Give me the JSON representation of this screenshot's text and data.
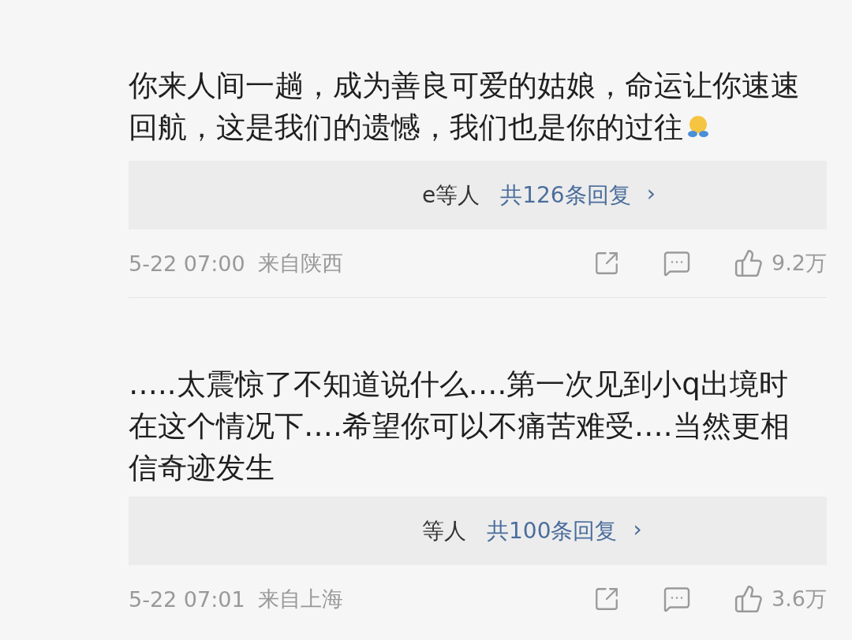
{
  "comments": [
    {
      "text": "你来人间一趟，成为善良可爱的姑娘，命运让你速速回航，这是我们的遗憾，我们也是你的过往",
      "emoji": true,
      "replies": {
        "names": "e等人",
        "count": "共126条回复",
        "chevron": "›"
      },
      "time": "5-22 07:00",
      "location": "来自陕西",
      "likes": "9.2万"
    },
    {
      "text": "…..太震惊了不知道说什么….第一次见到小q出境时在这个情况下….希望你可以不痛苦难受….当然更相信奇迹发生",
      "emoji": false,
      "replies": {
        "names": "等人",
        "count": "共100条回复",
        "chevron": "›"
      },
      "time": "5-22 07:01",
      "location": "来自上海",
      "likes": "3.6万"
    }
  ]
}
